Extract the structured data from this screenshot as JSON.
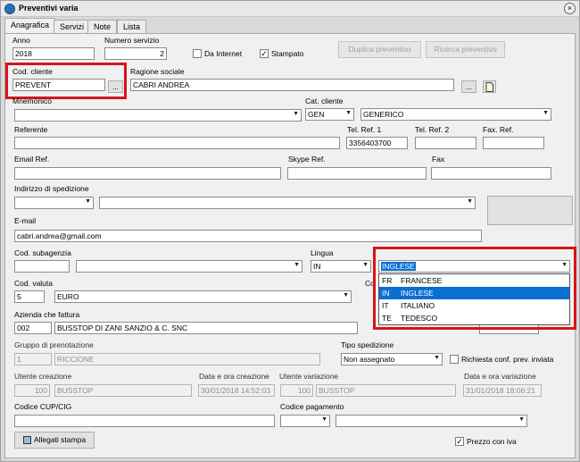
{
  "window": {
    "title": "Preventivi varia",
    "close": "×"
  },
  "tabs": [
    "Anagrafica",
    "Servizi",
    "Note",
    "Lista"
  ],
  "labels": {
    "anno": "Anno",
    "numero_servizio": "Numero servizio",
    "da_internet": "Da Internet",
    "stampato": "Stampato",
    "cod_cliente": "Cod. cliente",
    "ragione_sociale": "Ragione sociale",
    "mnemonico": "Mnemonico",
    "cat_cliente": "Cat. cliente",
    "referente": "Referente",
    "tel_ref1": "Tel. Ref. 1",
    "tel_ref2": "Tel. Ref. 2",
    "fax_ref": "Fax. Ref.",
    "email_ref": "Email Ref.",
    "skype_ref": "Skype Ref.",
    "fax": "Fax",
    "indirizzo_spedizione": "Indirizzo di spedizione",
    "email": "E-mail",
    "cod_subagenzia": "Cod. subagenzia",
    "lingua": "Lingua",
    "cod_valuta": "Cod. valuta",
    "co_trunc": "Co",
    "azienda_fattura": "Azienda che fattura",
    "gruppo_prenotazione": "Gruppo di prenotazione",
    "tipo_spedizione": "Tipo spedizione",
    "richiesta_conf": "Richiesta conf. prev. inviata",
    "utente_creazione": "Utente creazione",
    "data_creazione": "Data e ora creazione",
    "utente_variazione": "Utente variazione",
    "data_variazione": "Data e ora variazione",
    "codice_cup": "Codice CUP/CIG",
    "codice_pagamento": "Codice pagamento",
    "prezzo_iva": "Prezzo con iva"
  },
  "buttons": {
    "duplica": "Duplica preventivo",
    "ricerca": "Ricerca preventivo",
    "browse": "...",
    "allegati": "Allegati stampa"
  },
  "values": {
    "anno": "2018",
    "numero_servizio": "2",
    "cod_cliente": "PREVENT",
    "ragione_sociale": "CABRI ANDREA",
    "cat_cliente_code": "GEN",
    "cat_cliente_desc": "GENERICO",
    "tel_ref1": "3356403700",
    "email": "cabri.andrea@gmail.com",
    "lingua_code": "IN",
    "lingua_desc": "INGLESE",
    "cod_valuta": "5",
    "valuta_desc": "EURO",
    "azienda_code": "002",
    "azienda_desc": "BUSSTOP DI ZANI SANZIO & C. SNC",
    "gruppo_code": "1",
    "gruppo_desc": "RICCIONE",
    "tipo_spedizione": "Non assegnato",
    "utente_creazione_id": "100",
    "utente_creazione_name": "BUSSTOP",
    "data_creazione": "30/01/2018 14:52:03",
    "utente_variazione_id": "100",
    "utente_variazione_name": "BUSSTOP",
    "data_variazione": "31/01/2018 18:06:21"
  },
  "checkboxes": {
    "da_internet": false,
    "stampato": true,
    "richiesta_conf": false,
    "prezzo_iva": true
  },
  "lingua_options": [
    {
      "code": "FR",
      "name": "FRANCESE",
      "selected": false
    },
    {
      "code": "IN",
      "name": "INGLESE",
      "selected": true
    },
    {
      "code": "IT",
      "name": "ITALIANO",
      "selected": false
    },
    {
      "code": "TE",
      "name": "TEDESCO",
      "selected": false
    }
  ],
  "colors": {
    "highlight": "#d6141c",
    "selection": "#0a6ed2"
  }
}
